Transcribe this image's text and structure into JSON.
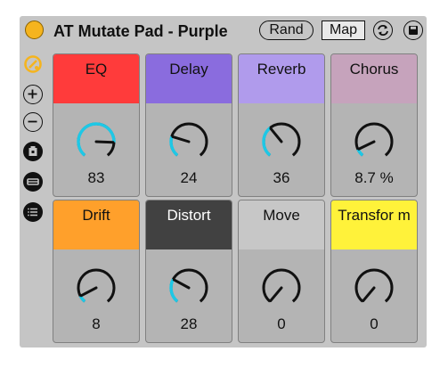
{
  "device": {
    "title": "AT Mutate Pad - Purple",
    "rand_label": "Rand",
    "map_label": "Map",
    "power_color": "#f5b41e"
  },
  "sidebar": {
    "icons": [
      "hot-swap-icon",
      "zoom-in-icon",
      "zoom-out-icon",
      "clipboard-icon",
      "variations-icon",
      "list-icon"
    ]
  },
  "colors": {
    "accent_arc": "#1ec8e6",
    "knob_stroke": "#111111"
  },
  "macros": [
    {
      "label": "EQ",
      "value": "83",
      "fraction": 0.83,
      "color": "#ff3b3b",
      "text_color": "#111111"
    },
    {
      "label": "Delay",
      "value": "24",
      "fraction": 0.24,
      "color": "#8a6cde",
      "text_color": "#111111"
    },
    {
      "label": "Reverb",
      "value": "36",
      "fraction": 0.36,
      "color": "#b09bec",
      "text_color": "#111111"
    },
    {
      "label": "Chorus",
      "value": "8.7 %",
      "fraction": 0.087,
      "color": "#c6a3bc",
      "text_color": "#111111"
    },
    {
      "label": "Drift",
      "value": "8",
      "fraction": 0.08,
      "color": "#ffa02b",
      "text_color": "#111111"
    },
    {
      "label": "Distort",
      "value": "28",
      "fraction": 0.28,
      "color": "#414141",
      "text_color": "#ffffff"
    },
    {
      "label": "Move",
      "value": "0",
      "fraction": 0,
      "color": "#c7c7c7",
      "text_color": "#111111"
    },
    {
      "label": "Transfor m",
      "value": "0",
      "fraction": 0,
      "color": "#fff23a",
      "text_color": "#111111"
    }
  ]
}
